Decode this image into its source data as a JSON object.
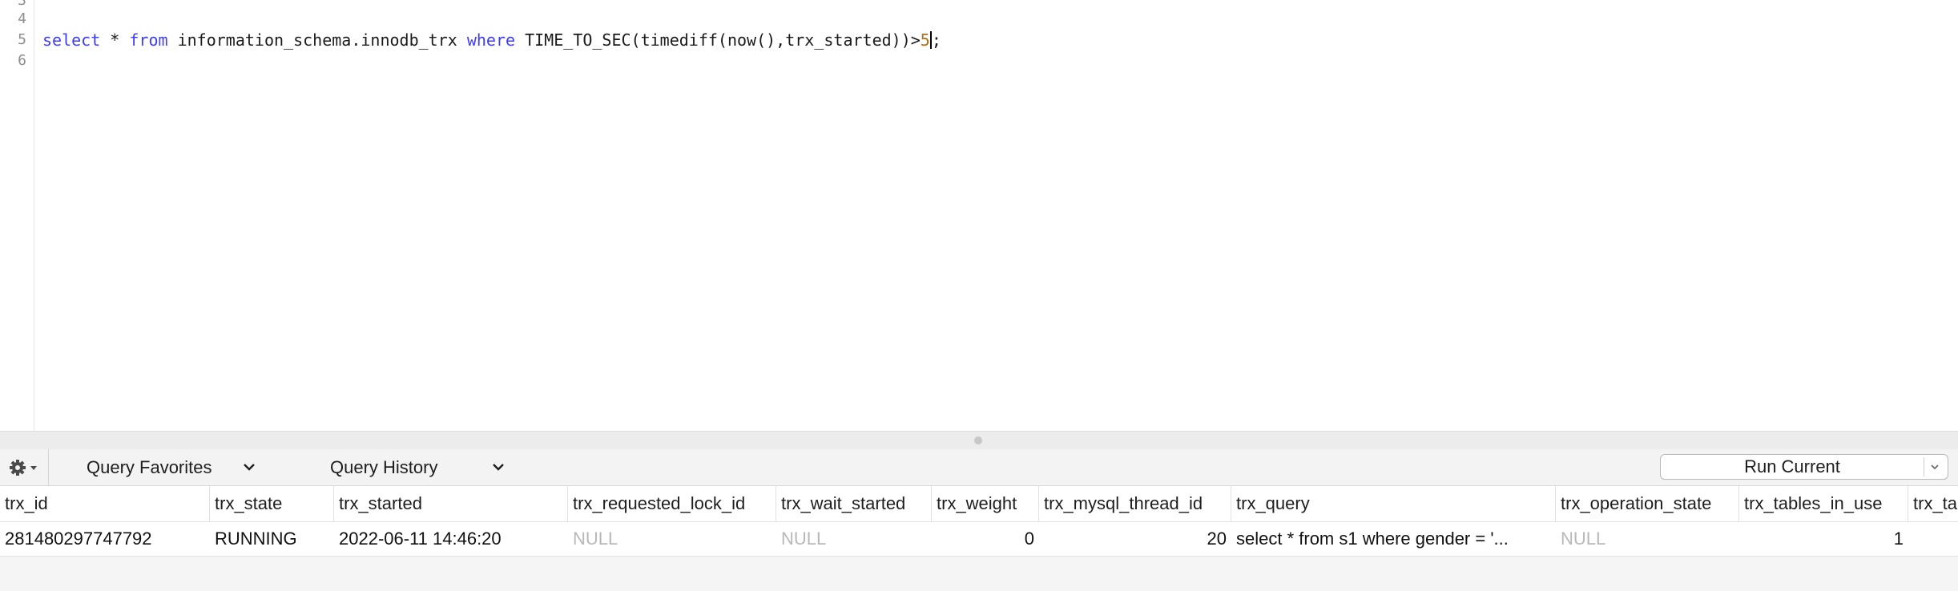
{
  "editor": {
    "line_numbers": [
      "3",
      "4",
      "5",
      "6"
    ],
    "code_tokens": [
      {
        "text": "select",
        "kind": "kw"
      },
      {
        "text": " * ",
        "kind": "txt"
      },
      {
        "text": "from",
        "kind": "kw"
      },
      {
        "text": " information_schema.innodb_trx ",
        "kind": "txt"
      },
      {
        "text": "where",
        "kind": "kw"
      },
      {
        "text": " TIME_TO_SEC(timediff(now(),trx_started))>",
        "kind": "txt"
      },
      {
        "text": "5",
        "kind": "num"
      },
      {
        "text": ";",
        "kind": "txt"
      }
    ]
  },
  "toolbar": {
    "gear_icon": "gear-icon",
    "favorites_label": "Query Favorites",
    "history_label": "Query History",
    "run_label": "Run Current"
  },
  "results": {
    "columns": [
      "trx_id",
      "trx_state",
      "trx_started",
      "trx_requested_lock_id",
      "trx_wait_started",
      "trx_weight",
      "trx_mysql_thread_id",
      "trx_query",
      "trx_operation_state",
      "trx_tables_in_use",
      "trx_ta"
    ],
    "rows": [
      [
        "281480297747792",
        "RUNNING",
        "2022-06-11 14:46:20",
        "NULL",
        "NULL",
        "0",
        "20",
        "select * from s1 where gender = '...",
        "NULL",
        "1",
        ""
      ]
    ]
  },
  "colors": {
    "keyword": "#3c3cff",
    "number": "#b0701c",
    "null_text": "#b8b8b8"
  }
}
